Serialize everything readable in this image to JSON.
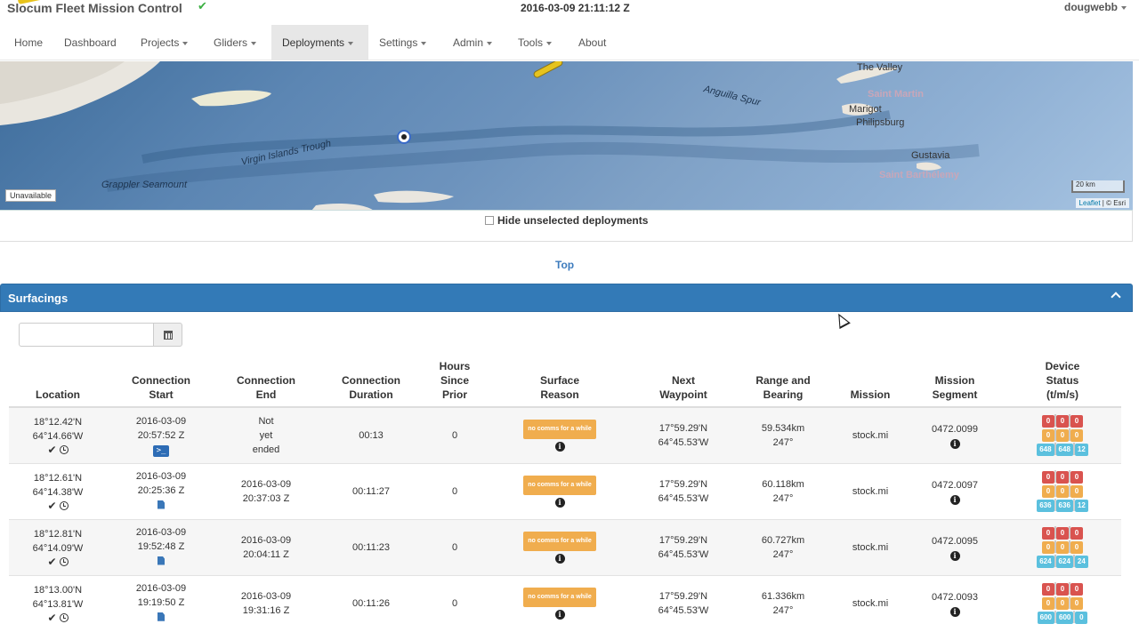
{
  "app": {
    "title": "Slocum Fleet Mission Control",
    "clock": "2016-03-09 21:11:12 Z",
    "user": "dougwebb"
  },
  "nav": {
    "items": [
      {
        "label": "Home",
        "dropdown": false
      },
      {
        "label": "Dashboard",
        "dropdown": false
      },
      {
        "label": "Projects",
        "dropdown": true
      },
      {
        "label": "Gliders",
        "dropdown": true
      },
      {
        "label": "Deployments",
        "dropdown": true,
        "active": true
      },
      {
        "label": "Settings",
        "dropdown": true
      },
      {
        "label": "Admin",
        "dropdown": true
      },
      {
        "label": "Tools",
        "dropdown": true
      },
      {
        "label": "About",
        "dropdown": false
      }
    ]
  },
  "map": {
    "labels": {
      "virgin_islands_trough": "Virgin Islands Trough",
      "anguilla_spur": "Anguilla Spur",
      "grappler_seamount": "Grappler Seamount",
      "the_valley": "The Valley",
      "saint_martin": "Saint Martin",
      "marigot": "Marigot",
      "philipsburg": "Philipsburg",
      "gustavia": "Gustavia",
      "saint_barthelemy": "Saint Barthélemy"
    },
    "unavailable": "Unavailable",
    "scale": "20 km",
    "attribution_link": "Leaflet",
    "attribution_rest": " | © Esri"
  },
  "filters": {
    "hide_unselected_label": "Hide unselected deployments",
    "hide_unselected_checked": false
  },
  "top_link": "Top",
  "surfacings": {
    "title": "Surfacings",
    "date_filter_value": "",
    "headers": {
      "location": "Location",
      "connection_start": [
        "Connection",
        "Start"
      ],
      "connection_end": [
        "Connection",
        "End"
      ],
      "connection_duration": [
        "Connection",
        "Duration"
      ],
      "hours_since_prior": [
        "Hours",
        "Since",
        "Prior"
      ],
      "surface_reason": [
        "Surface",
        "Reason"
      ],
      "next_waypoint": [
        "Next",
        "Waypoint"
      ],
      "range_bearing": [
        "Range and",
        "Bearing"
      ],
      "mission": "Mission",
      "mission_segment": [
        "Mission",
        "Segment"
      ],
      "device_status": [
        "Device",
        "Status",
        "(t/m/s)"
      ]
    },
    "rows": [
      {
        "lat": "18°12.42'N",
        "lon": "64°14.66'W",
        "start_date": "2016-03-09",
        "start_time": "20:57:52 Z",
        "start_icon": "terminal-icon",
        "end_lines": [
          "Not",
          "yet",
          "ended"
        ],
        "duration": "00:13",
        "hours_since_prior": "0",
        "reason": "no comms for a while",
        "wp_lat": "17°59.29'N",
        "wp_lon": "64°45.53'W",
        "range": "59.534km",
        "bearing": "247°",
        "mission": "stock.mi",
        "segment": "0472.0099",
        "status": {
          "t": [
            "0",
            "0",
            "0"
          ],
          "m": [
            "0",
            "0",
            "0"
          ],
          "s": [
            "648",
            "648",
            "12"
          ]
        }
      },
      {
        "lat": "18°12.61'N",
        "lon": "64°14.38'W",
        "start_date": "2016-03-09",
        "start_time": "20:25:36 Z",
        "start_icon": "document-icon",
        "end_lines": [
          "2016-03-09",
          "20:37:03 Z"
        ],
        "duration": "00:11:27",
        "hours_since_prior": "0",
        "reason": "no comms for a while",
        "wp_lat": "17°59.29'N",
        "wp_lon": "64°45.53'W",
        "range": "60.118km",
        "bearing": "247°",
        "mission": "stock.mi",
        "segment": "0472.0097",
        "status": {
          "t": [
            "0",
            "0",
            "0"
          ],
          "m": [
            "0",
            "0",
            "0"
          ],
          "s": [
            "636",
            "636",
            "12"
          ]
        }
      },
      {
        "lat": "18°12.81'N",
        "lon": "64°14.09'W",
        "start_date": "2016-03-09",
        "start_time": "19:52:48 Z",
        "start_icon": "document-icon",
        "end_lines": [
          "2016-03-09",
          "20:04:11 Z"
        ],
        "duration": "00:11:23",
        "hours_since_prior": "0",
        "reason": "no comms for a while",
        "wp_lat": "17°59.29'N",
        "wp_lon": "64°45.53'W",
        "range": "60.727km",
        "bearing": "247°",
        "mission": "stock.mi",
        "segment": "0472.0095",
        "status": {
          "t": [
            "0",
            "0",
            "0"
          ],
          "m": [
            "0",
            "0",
            "0"
          ],
          "s": [
            "624",
            "624",
            "24"
          ]
        }
      },
      {
        "lat": "18°13.00'N",
        "lon": "64°13.81'W",
        "start_date": "2016-03-09",
        "start_time": "19:19:50 Z",
        "start_icon": "document-icon",
        "end_lines": [
          "2016-03-09",
          "19:31:16 Z"
        ],
        "duration": "00:11:26",
        "hours_since_prior": "0",
        "reason": "no comms for a while",
        "wp_lat": "17°59.29'N",
        "wp_lon": "64°45.53'W",
        "range": "61.336km",
        "bearing": "247°",
        "mission": "stock.mi",
        "segment": "0472.0093",
        "status": {
          "t": [
            "0",
            "0",
            "0"
          ],
          "m": [
            "0",
            "0",
            "0"
          ],
          "s": [
            "600",
            "600",
            "0"
          ]
        }
      }
    ]
  },
  "colors": {
    "panel_header": "#337ab7",
    "reason_badge": "#f0ad4e",
    "status_t": "#d9534f",
    "status_m": "#f0ad4e",
    "status_s": "#5bc0de"
  }
}
